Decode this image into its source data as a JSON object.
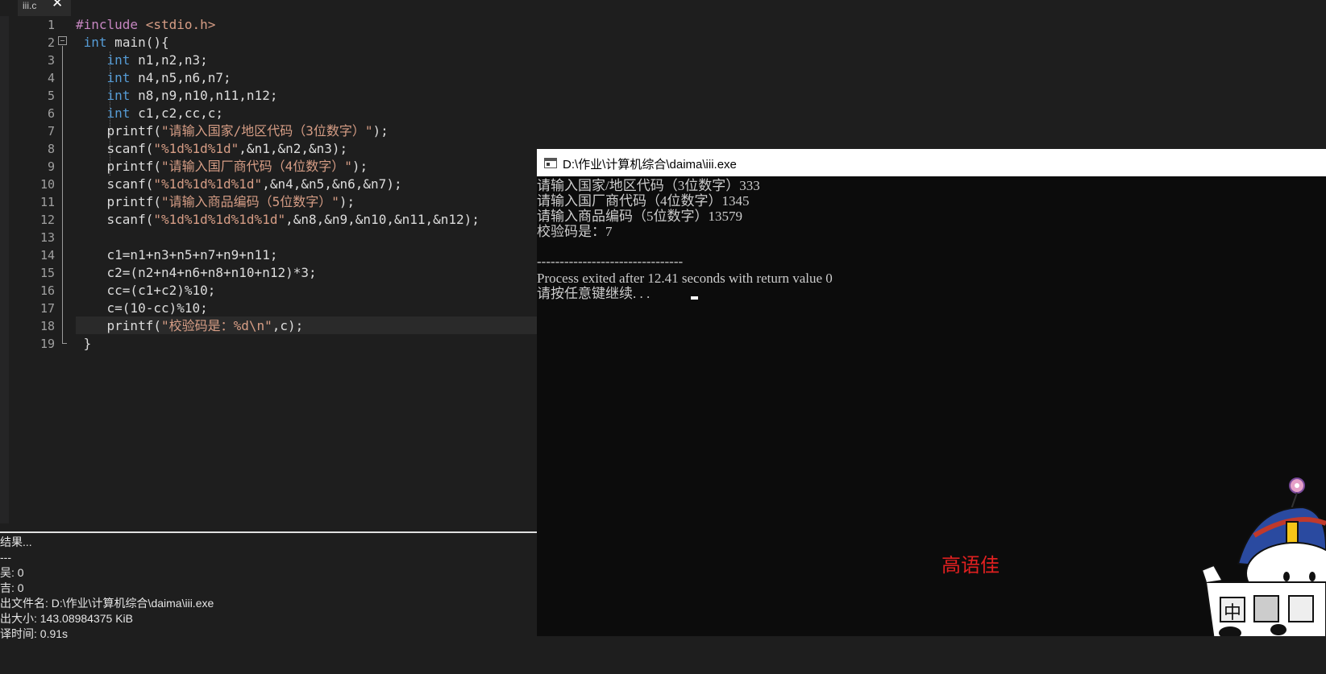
{
  "tab": {
    "filename": "iii.c",
    "close_glyph": "✕"
  },
  "editor": {
    "line_numbers": [
      "1",
      "2",
      "3",
      "4",
      "5",
      "6",
      "7",
      "8",
      "9",
      "10",
      "11",
      "12",
      "13",
      "14",
      "15",
      "16",
      "17",
      "18",
      "19"
    ]
  },
  "compile_log": {
    "lines": [
      "结果...",
      "---",
      "吴: 0",
      "吉: 0",
      "出文件名: D:\\作业\\计算机综合\\daima\\iii.exe",
      "出大小: 143.08984375 KiB",
      "译时间: 0.91s"
    ]
  },
  "console": {
    "title": "D:\\作业\\计算机综合\\daima\\iii.exe",
    "output": [
      "请输入国家/地区代码（3位数字）333",
      "请输入国厂商代码（4位数字）1345",
      "请输入商品编码（5位数字）13579",
      "校验码是：7",
      "",
      "--------------------------------",
      "Process exited after 12.41 seconds with return value 0",
      "请按任意键继续. . ."
    ],
    "watermark": "高语佳"
  },
  "colors": {
    "keyword": "#569cd6",
    "string": "#d69d85",
    "preprocessor": "#c586c0",
    "watermark": "#e02020"
  }
}
